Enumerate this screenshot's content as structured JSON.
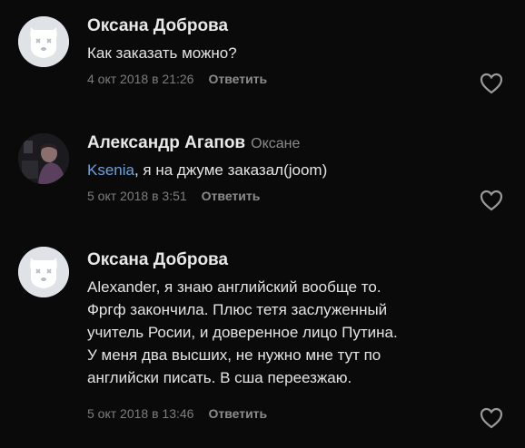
{
  "comments": [
    {
      "author": "Оксана Доброва",
      "reply_to": "",
      "mention": "",
      "text_lines": [
        "Как заказать можно?"
      ],
      "date": "4 окт 2018 в 21:26",
      "reply_label": "Ответить",
      "avatar": "deactivated-dog-avatar"
    },
    {
      "author": "Александр Агапов",
      "reply_to": "Оксане",
      "mention": "Ksenia",
      "text_lines": [
        ", я на джуме заказал(joom)"
      ],
      "date": "5 окт 2018 в 3:51",
      "reply_label": "Ответить",
      "avatar": "photo-avatar"
    },
    {
      "author": "Оксана Доброва",
      "reply_to": "",
      "mention": "",
      "text_lines": [
        "Alexander, я знаю английский вообще то.",
        "Фргф закончила. Плюс тетя заслуженный",
        "учитель Росии, и доверенное лицо Путина.",
        "У меня два высших, не нужно мне тут по",
        "английски писать. В сша переезжаю."
      ],
      "date": "5 окт 2018 в 13:46",
      "reply_label": "Ответить",
      "avatar": "deactivated-dog-avatar"
    }
  ],
  "colors": {
    "background": "#0a0a0a",
    "text": "#e4e4e4",
    "muted": "#7d7d7d",
    "mention": "#6fa0d8"
  },
  "icons": {
    "like": "heart-icon"
  }
}
